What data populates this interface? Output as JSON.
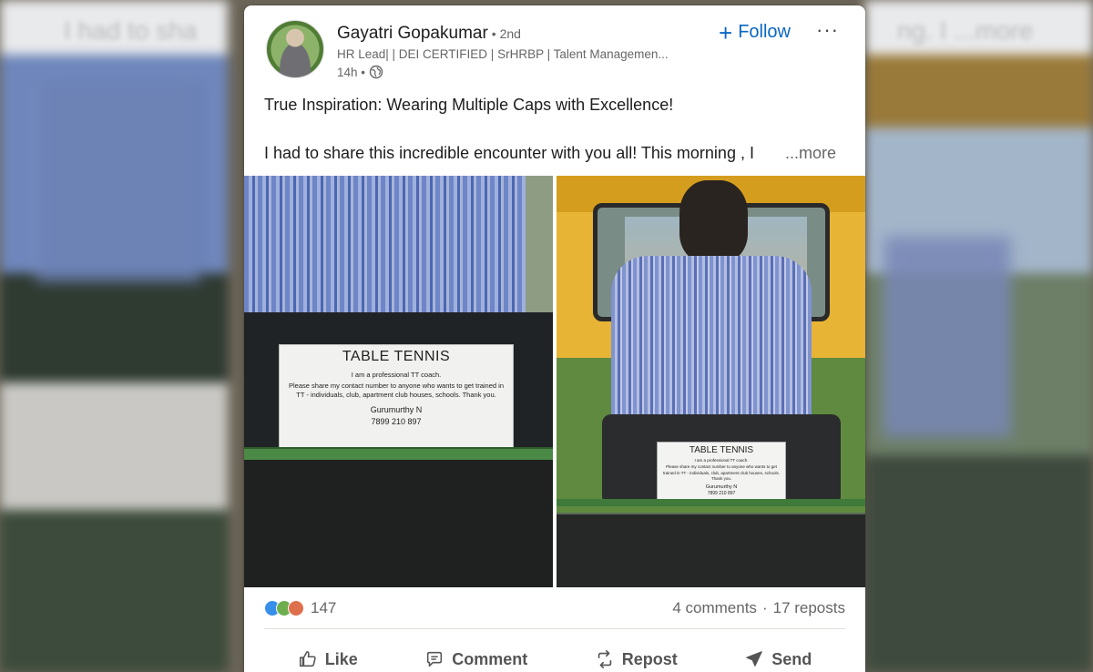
{
  "background": {
    "blurred_text_left": "I had to sha",
    "blurred_text_right": "ng. I ...more"
  },
  "post": {
    "author": {
      "name": "Gayatri Gopakumar",
      "degree": "• 2nd",
      "headline": "HR Lead| | DEI CERTIFIED | SrHRBP | Talent Managemen...",
      "time": "14h •"
    },
    "follow_label": "Follow",
    "more_label": "···",
    "text_line1": "True Inspiration: Wearing Multiple Caps with Excellence!",
    "text_line2": "I had to share this incredible encounter with you all! This morning , I",
    "see_more": "...more",
    "images": {
      "left_sign": {
        "title": "TABLE TENNIS",
        "line1": "I am a professional TT coach.",
        "line2": "Please share my contact number to anyone who wants to get trained in TT - individuals, club, apartment club houses, schools. Thank you.",
        "name": "Gurumurthy N",
        "phone": "7899 210 897"
      },
      "right_sign": {
        "title": "TABLE TENNIS",
        "line1": "I am a professional TT coach.",
        "line2": "Please share my contact number to anyone who wants to get trained in TT - individuals, club, apartment club houses, schools. Thank you.",
        "name": "Gurumurthy N",
        "phone": "7899 210 897"
      }
    },
    "reactions_count": "147",
    "comments": "4 comments",
    "separator": "·",
    "reposts": "17 reposts",
    "actions": {
      "like": "Like",
      "comment": "Comment",
      "repost": "Repost",
      "send": "Send"
    }
  },
  "colors": {
    "link_blue": "#0a66c2",
    "text_primary": "#1d1d1d",
    "text_secondary": "#666666"
  }
}
